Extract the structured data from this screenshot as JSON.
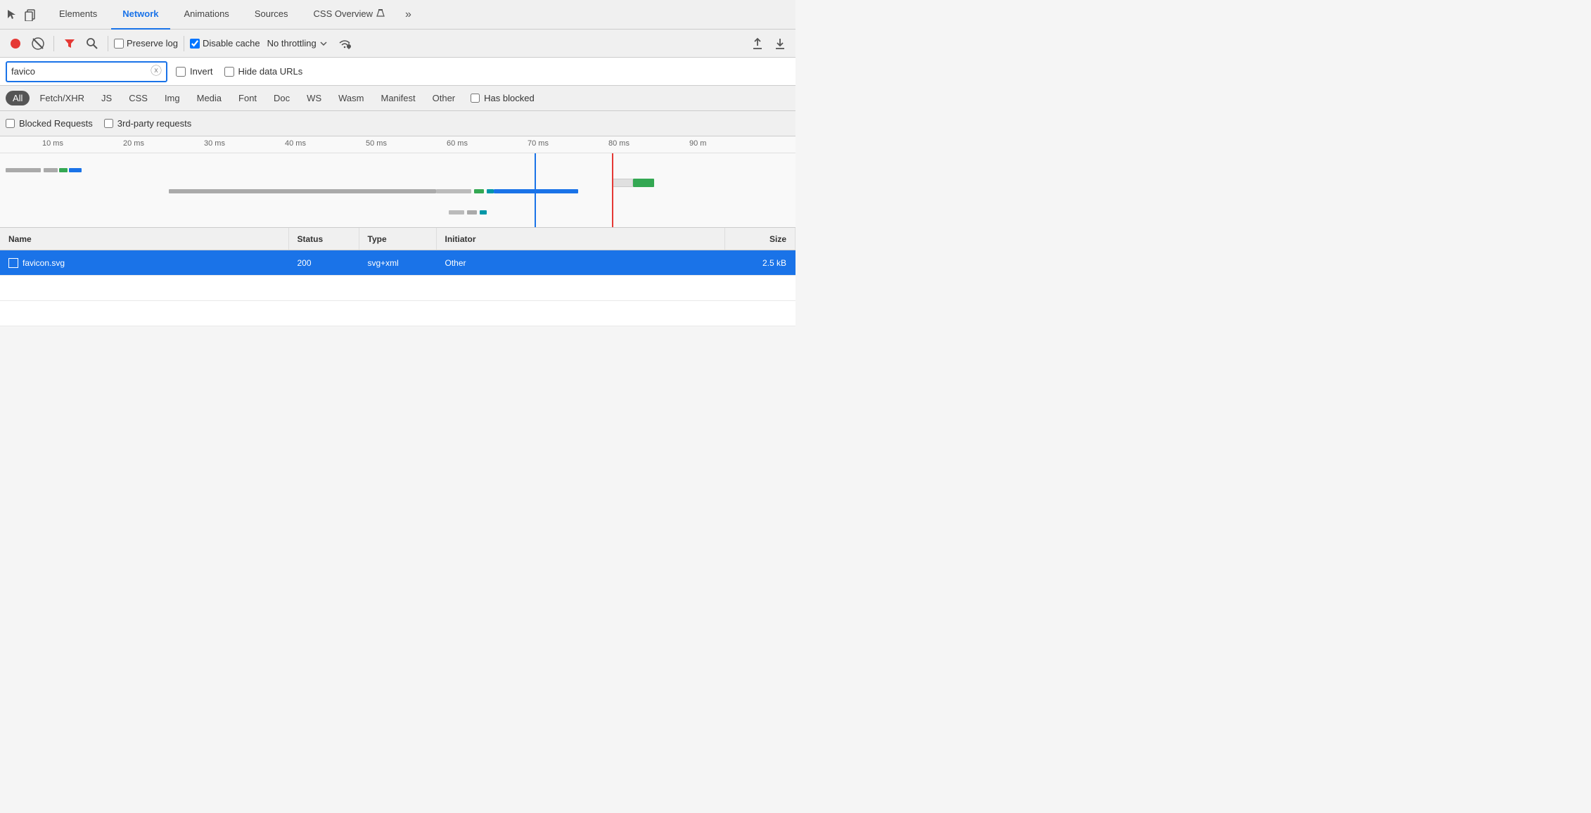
{
  "tabs": {
    "items": [
      {
        "label": "Elements",
        "active": false
      },
      {
        "label": "Network",
        "active": true
      },
      {
        "label": "Animations",
        "active": false
      },
      {
        "label": "Sources",
        "active": false
      },
      {
        "label": "CSS Overview",
        "active": false
      }
    ],
    "more_label": "»"
  },
  "toolbar": {
    "preserve_log_label": "Preserve log",
    "disable_cache_label": "Disable cache",
    "disable_cache_checked": true,
    "no_throttling_label": "No throttling"
  },
  "search": {
    "value": "favico",
    "placeholder": "",
    "invert_label": "Invert",
    "hide_data_urls_label": "Hide data URLs"
  },
  "filter_bar": {
    "filters": [
      {
        "label": "All",
        "active": true
      },
      {
        "label": "Fetch/XHR",
        "active": false
      },
      {
        "label": "JS",
        "active": false
      },
      {
        "label": "CSS",
        "active": false
      },
      {
        "label": "Img",
        "active": false
      },
      {
        "label": "Media",
        "active": false
      },
      {
        "label": "Font",
        "active": false
      },
      {
        "label": "Doc",
        "active": false
      },
      {
        "label": "WS",
        "active": false
      },
      {
        "label": "Wasm",
        "active": false
      },
      {
        "label": "Manifest",
        "active": false
      },
      {
        "label": "Other",
        "active": false
      }
    ],
    "has_blocked_label": "Has blocked"
  },
  "blocked_bar": {
    "blocked_requests_label": "Blocked Requests",
    "third_party_label": "3rd-party requests"
  },
  "timeline": {
    "ruler_marks": [
      "10 ms",
      "20 ms",
      "30 ms",
      "40 ms",
      "50 ms",
      "60 ms",
      "70 ms",
      "80 ms",
      "90 m"
    ]
  },
  "table": {
    "headers": {
      "name": "Name",
      "status": "Status",
      "type": "Type",
      "initiator": "Initiator",
      "size": "Size"
    },
    "rows": [
      {
        "name": "favicon.svg",
        "status": "200",
        "type": "svg+xml",
        "initiator": "Other",
        "size": "2.5 kB",
        "selected": true
      }
    ]
  }
}
